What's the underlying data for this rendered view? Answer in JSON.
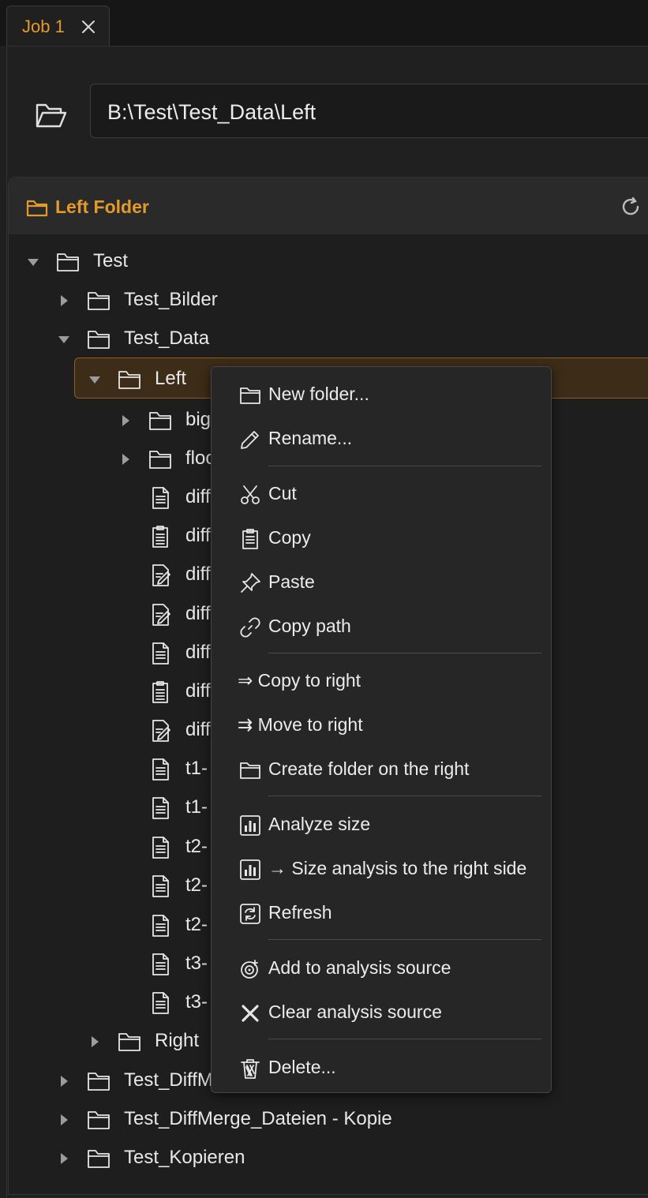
{
  "tab": {
    "label": "Job 1"
  },
  "path": {
    "value": "B:\\Test\\Test_Data\\Left"
  },
  "panel": {
    "title": "Left Folder"
  },
  "tree": [
    {
      "label": "Test",
      "type": "folder",
      "depth": 0,
      "expanded": true
    },
    {
      "label": "Test_Bilder",
      "type": "folder",
      "depth": 1,
      "expanded": false
    },
    {
      "label": "Test_Data",
      "type": "folder",
      "depth": 1,
      "expanded": true
    },
    {
      "label": "Left",
      "type": "folder",
      "depth": 2,
      "expanded": true,
      "selected": true
    },
    {
      "label": "big",
      "type": "folder",
      "depth": 3,
      "expanded": false
    },
    {
      "label": "floo",
      "type": "folder",
      "depth": 3,
      "expanded": false
    },
    {
      "label": "diff",
      "type": "file",
      "depth": 3
    },
    {
      "label": "diff",
      "type": "clipboard",
      "depth": 3
    },
    {
      "label": "diff",
      "type": "edit",
      "depth": 3
    },
    {
      "label": "diff",
      "type": "edit",
      "depth": 3
    },
    {
      "label": "diff",
      "type": "file",
      "depth": 3
    },
    {
      "label": "diff",
      "type": "clipboard",
      "depth": 3
    },
    {
      "label": "diff",
      "type": "edit",
      "depth": 3
    },
    {
      "label": "t1-",
      "type": "file",
      "depth": 3
    },
    {
      "label": "t1-",
      "type": "file",
      "depth": 3
    },
    {
      "label": "t2-",
      "type": "file",
      "depth": 3
    },
    {
      "label": "t2-",
      "type": "file",
      "depth": 3
    },
    {
      "label": "t2-",
      "type": "file",
      "depth": 3
    },
    {
      "label": "t3-",
      "type": "file",
      "depth": 3
    },
    {
      "label": "t3-",
      "type": "file",
      "depth": 3
    },
    {
      "label": "Right",
      "type": "folder",
      "depth": 2,
      "expanded": false
    },
    {
      "label": "Test_DiffM",
      "type": "folder",
      "depth": 1,
      "expanded": false
    },
    {
      "label": "Test_DiffMerge_Dateien - Kopie",
      "type": "folder",
      "depth": 1,
      "expanded": false
    },
    {
      "label": "Test_Kopieren",
      "type": "folder",
      "depth": 1,
      "expanded": false
    }
  ],
  "menu": {
    "items": [
      {
        "label": "New folder...",
        "icon": "folder-icon"
      },
      {
        "label": "Rename...",
        "icon": "pencil-icon"
      },
      {
        "sep": true
      },
      {
        "label": "Cut",
        "icon": "scissors-icon"
      },
      {
        "label": "Copy",
        "icon": "clipboard-icon"
      },
      {
        "label": "Paste",
        "icon": "pin-icon"
      },
      {
        "label": "Copy path",
        "icon": "link-icon"
      },
      {
        "sep": true
      },
      {
        "label": "⇒ Copy to right",
        "icon": ""
      },
      {
        "label": "⇉ Move to right",
        "icon": ""
      },
      {
        "label": "Create folder on the right",
        "icon": "folder-icon"
      },
      {
        "sep": true
      },
      {
        "label": "Analyze size",
        "icon": "bar-chart-icon"
      },
      {
        "label": "→ Size analysis to the right side",
        "icon": "bar-chart-icon"
      },
      {
        "label": "Refresh",
        "icon": "refresh-box-icon"
      },
      {
        "sep": true
      },
      {
        "label": "Add to analysis source",
        "icon": "target-add-icon"
      },
      {
        "label": "Clear analysis source",
        "icon": "x-icon"
      },
      {
        "sep": true
      },
      {
        "label": "Delete...",
        "icon": "trash-icon"
      }
    ]
  }
}
